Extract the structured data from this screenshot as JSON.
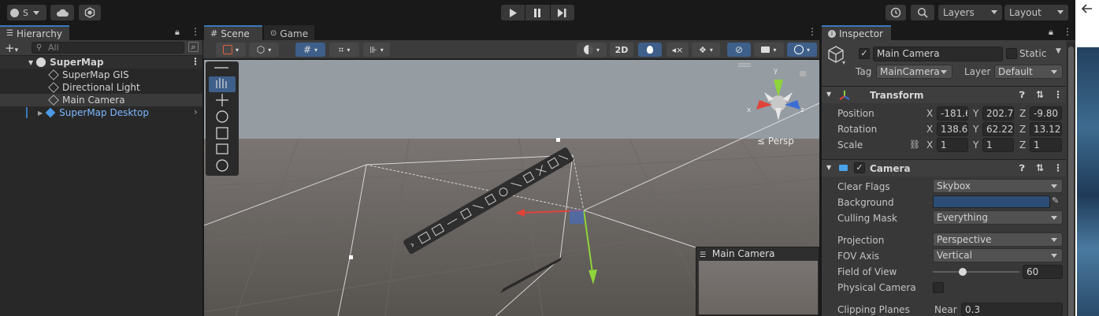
{
  "toolbar": {
    "account_label": "S",
    "layers_label": "Layers",
    "layout_label": "Layout"
  },
  "hierarchy": {
    "tab_label": "Hierarchy",
    "search_placeholder": "All",
    "items": [
      {
        "label": "SuperMap"
      },
      {
        "label": "SuperMap GIS"
      },
      {
        "label": "Directional Light"
      },
      {
        "label": "Main Camera"
      },
      {
        "label": "SuperMap Desktop"
      }
    ]
  },
  "scene": {
    "tabs": [
      {
        "label": "Scene"
      },
      {
        "label": "Game"
      }
    ],
    "toggle_2d": "2D",
    "persp_label": "Persp",
    "gizmo_y": "y",
    "gizmo_x": "x",
    "gizmo_z": "z",
    "camera_preview_title": "Main Camera"
  },
  "inspector": {
    "tab_label": "Inspector",
    "object_name": "Main Camera",
    "static_label": "Static",
    "tag_label": "Tag",
    "tag_value": "MainCamera",
    "layer_label": "Layer",
    "layer_value": "Default",
    "transform": {
      "title": "Transform",
      "position_label": "Position",
      "rotation_label": "Rotation",
      "scale_label": "Scale",
      "position": {
        "x": "-181.6",
        "y": "202.78",
        "z": "-9.80"
      },
      "rotation": {
        "x": "138.64",
        "y": "62.229",
        "z": "13.121"
      },
      "scale": {
        "x": "1",
        "y": "1",
        "z": "1"
      }
    },
    "camera": {
      "title": "Camera",
      "clear_flags_label": "Clear Flags",
      "clear_flags_value": "Skybox",
      "background_label": "Background",
      "background_color": "#2c4d75",
      "culling_mask_label": "Culling Mask",
      "culling_mask_value": "Everything",
      "projection_label": "Projection",
      "projection_value": "Perspective",
      "fov_axis_label": "FOV Axis",
      "fov_axis_value": "Vertical",
      "fov_label": "Field of View",
      "fov_value": "60",
      "fov_fraction": 0.33,
      "physical_camera_label": "Physical Camera",
      "clipping_planes_label": "Clipping Planes",
      "near_label": "Near",
      "near_value": "0.3"
    }
  },
  "colors": {
    "accent": "#3a79bb",
    "prefab_blue": "#7cb7ff",
    "axis_x": "#e0433a",
    "axis_y": "#8ed43a",
    "axis_z": "#3c6fd6"
  }
}
